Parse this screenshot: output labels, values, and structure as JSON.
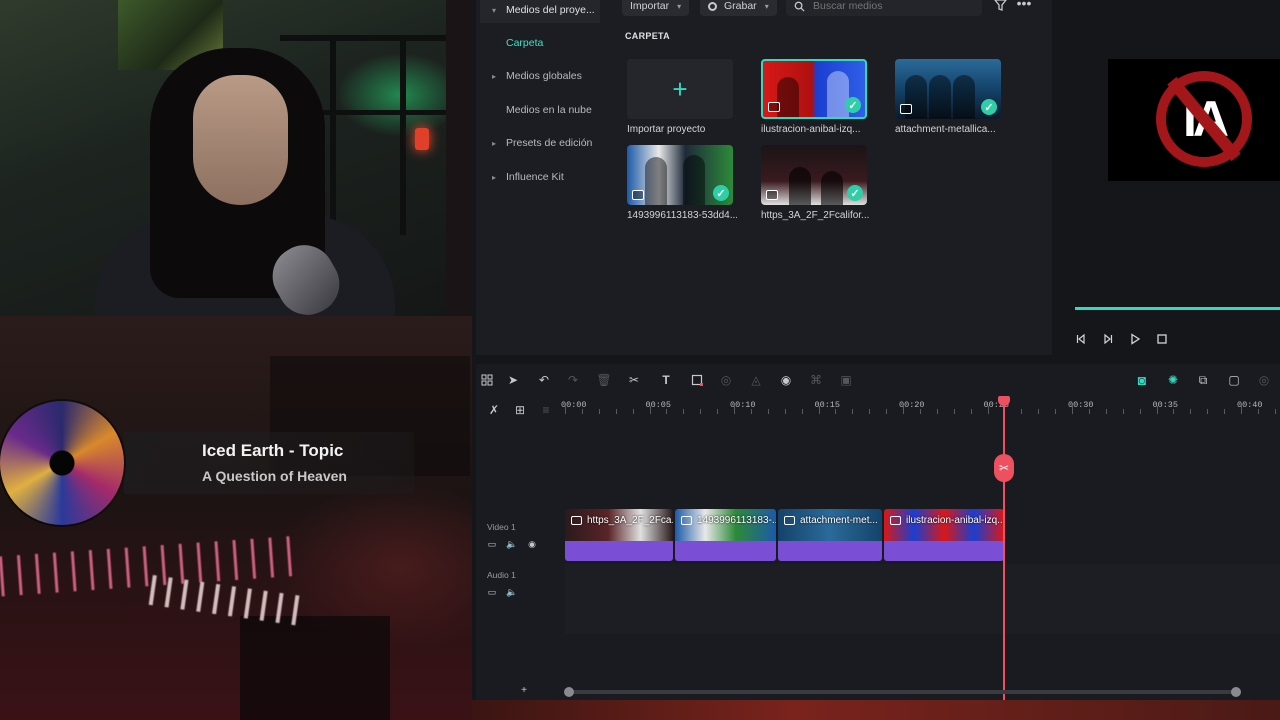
{
  "stream_overlay": {
    "artist": "Iced Earth - Topic",
    "song": "A Question of Heaven"
  },
  "media_panel": {
    "sidebar": [
      {
        "label": "Medios del proye...",
        "caret": "▾",
        "state": "expanded"
      },
      {
        "label": "Carpeta",
        "state": "active"
      },
      {
        "label": "Medios globales",
        "caret": "▸"
      },
      {
        "label": "Medios en la nube"
      },
      {
        "label": "Presets de edición",
        "caret": "▸"
      },
      {
        "label": "Influence Kit",
        "caret": "▸"
      }
    ],
    "toolbar": {
      "import_label": "Importar",
      "record_label": "Grabar",
      "search_placeholder": "Buscar medios"
    },
    "folder_label": "CARPETA",
    "tiles": [
      {
        "name": "Importar proyecto",
        "kind": "import"
      },
      {
        "name": "ilustracion-anibal-izq...",
        "selected": true,
        "checked": true
      },
      {
        "name": "attachment-metallica...",
        "checked": true
      },
      {
        "name": "1493996113183-53dd4...",
        "checked": true
      },
      {
        "name": "https_3A_2F_2Fcalifor...",
        "checked": true
      }
    ]
  },
  "preview": {
    "overlay_text": "IA"
  },
  "timeline": {
    "ruler_labels": [
      "00:00",
      "00:05",
      "00:10",
      "00:15",
      "00:20",
      "00:25",
      "00:30",
      "00:35",
      "00:40"
    ],
    "tracks": [
      {
        "label": "Video 1"
      },
      {
        "label": "Audio 1"
      }
    ],
    "clips": [
      {
        "title": "https_3A_2F_2Fca..."
      },
      {
        "title": "1493996113183-..."
      },
      {
        "title": "attachment-met..."
      },
      {
        "title": "ilustracion-anibal-izq..."
      }
    ],
    "accent_color": "#35d9bf",
    "playhead_color": "#ef5060",
    "clip_color": "#7a4fd6"
  }
}
